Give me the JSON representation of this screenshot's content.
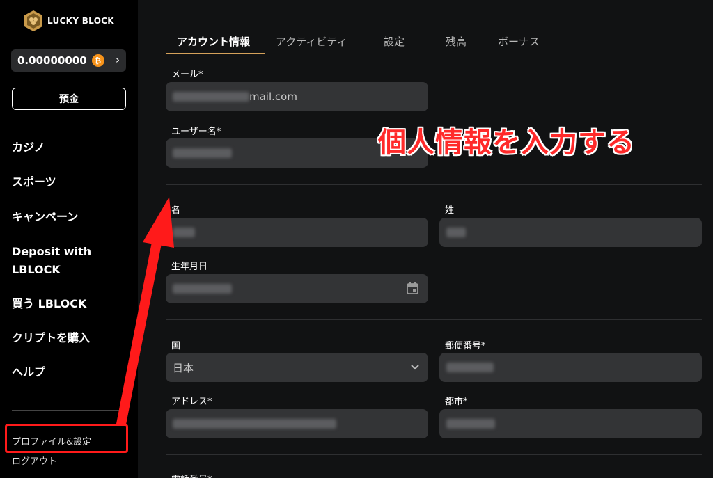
{
  "sidebar": {
    "logo_text": "LUCKY BLOCK",
    "balance": "0.00000000",
    "currency_symbol": "₿",
    "deposit_label": "預金",
    "nav": [
      "カジノ",
      "スポーツ",
      "キャンペーン",
      "Deposit with LBLOCK",
      "買う LBLOCK",
      "クリプトを購入",
      "ヘルプ"
    ],
    "profile_link": "プロファイル&設定",
    "logout_link": "ログアウト"
  },
  "tabs": [
    "アカウント情報",
    "アクティビティ",
    "設定",
    "残高",
    "ボーナス"
  ],
  "form": {
    "email_label": "メール*",
    "email_value_suffix": "mail.com",
    "username_label": "ユーザー名*",
    "first_name_label": "名",
    "last_name_label": "姓",
    "birthdate_label": "生年月日",
    "country_label": "国",
    "country_value": "日本",
    "postal_label": "郵便番号*",
    "address_label": "アドレス*",
    "city_label": "都市*",
    "phone_label": "電話番号*"
  },
  "annotation": {
    "text": "個人情報を入力する",
    "color": "#ff2a2a"
  },
  "colors": {
    "accent": "#d4a15a",
    "field_bg": "#333436",
    "highlight": "#ff1a1a"
  }
}
